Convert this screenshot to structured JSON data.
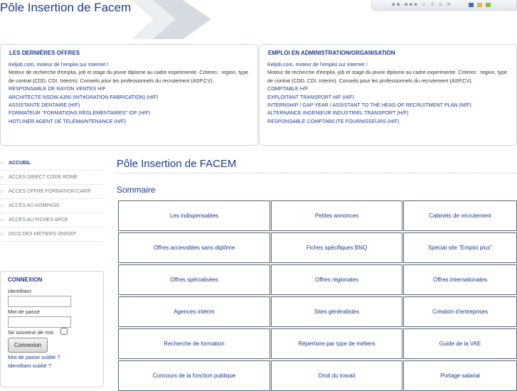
{
  "header": {
    "site_title": "Pôle Insertion de Facem",
    "tool_icons": "▪▪ ▪▪▪ ◇ ♙ ⌂ ≡",
    "swatch_colors": [
      "#3d6fb5",
      "#f2b43c",
      "#8cbf3f"
    ]
  },
  "box_left": {
    "title": "LES DERNIÈRES OFFRES",
    "items": [
      {
        "kind": "link",
        "text": "Keljob.com, moteur de l'emploi sur Internet !"
      },
      {
        "kind": "desc",
        "text": "Moteur de recherche d'emploi, job et stage du jeune diplome au cadre experimente. Criteres : region, type de contrat (CDD, CDI, Interim). Conseils pour les professionnels du recrutement (ASP,CV)."
      },
      {
        "kind": "link",
        "text": "RESPONSABLE DE RAYON VENTES H/F"
      },
      {
        "kind": "link",
        "text": "ARCHITECTE NSDW A350 (INTéGRATION FABRICATION) (H/F)"
      },
      {
        "kind": "link",
        "text": "ASSISTANTE DENTAIRE (H/F)"
      },
      {
        "kind": "link",
        "text": "FORMATEUR \"FORMATIONS RÉGLEMENTAIRES\" IDF (H/F)"
      },
      {
        "kind": "link",
        "text": "HOTLINER AGENT DE TELEMAINTENANCE (H/F)"
      }
    ]
  },
  "box_right": {
    "title": "EMPLOI EN ADMINISTRATION/ORGANISATION",
    "items": [
      {
        "kind": "link",
        "text": "Keljob.com, moteur de l'emploi sur Internet !"
      },
      {
        "kind": "desc",
        "text": "Moteur de recherche d'emploi, job et stage du jeune diplome au cadre experimente. Criteres : region, type de contrat (CDD, CDI, Interim). Conseils pour les professionnels du recrutement (ASP,CV)."
      },
      {
        "kind": "link",
        "text": "COMPTABLE H/F"
      },
      {
        "kind": "link",
        "text": "EXPLOITANT TRANSPORT H/F (H/F)"
      },
      {
        "kind": "link",
        "text": "INTERNSHIP / GAP YEAR / ASSISTANT TO THE HEAD OF RECRUITMENT PLAN (M/F)"
      },
      {
        "kind": "link",
        "text": "ALTERNANCE INGÉNIEUR INDUSTRIEL TRANSPORT (H/F)"
      },
      {
        "kind": "link",
        "text": "RESPONSABLE COMPTABILITE FOURNISSEURS (H/F)"
      }
    ]
  },
  "nav": {
    "items": [
      {
        "label": "ACCUEIL",
        "active": true
      },
      {
        "label": "ACCES DIRECT CODE ROME",
        "active": false
      },
      {
        "label": "ACCES OFFRE FORMATION CARIF",
        "active": false
      },
      {
        "label": "ACCÈS AU KOMPASS",
        "active": false
      },
      {
        "label": "ACCÈS AU FICHES APCE",
        "active": false
      },
      {
        "label": "DICO DES MÉTIERS ONISEP",
        "active": false
      }
    ]
  },
  "login": {
    "title": "CONNEXION",
    "username_label": "Identifiant",
    "password_label": "Mot de passe",
    "remember_label": "Se souvenir de moi",
    "submit_label": "Connexion",
    "forgot_password": "Mot de passe oublié ?",
    "forgot_username": "Identifiant oublié ?"
  },
  "main": {
    "title": "Pôle Insertion de FACEM",
    "section": "Sommaire",
    "grid": [
      [
        "Les indispensables",
        "Petites annonces",
        "Cabinets de recrutement"
      ],
      [
        "Offres accessibles sans diplôme",
        "Fiches spécifiques BNQ",
        "Spécial site \"Emploi plus\""
      ],
      [
        "Offres spécialisées",
        "Offres régionales",
        "Offres internationales"
      ],
      [
        "Agences intérim",
        "Sites généralistes",
        "Création d'entreprises"
      ],
      [
        "Recherche de formation",
        "Répertoire par type de métiers",
        "Guide de la VAE"
      ],
      [
        "Concours de la fonction publique",
        "Droit du travail",
        "Portage salarial"
      ]
    ]
  }
}
